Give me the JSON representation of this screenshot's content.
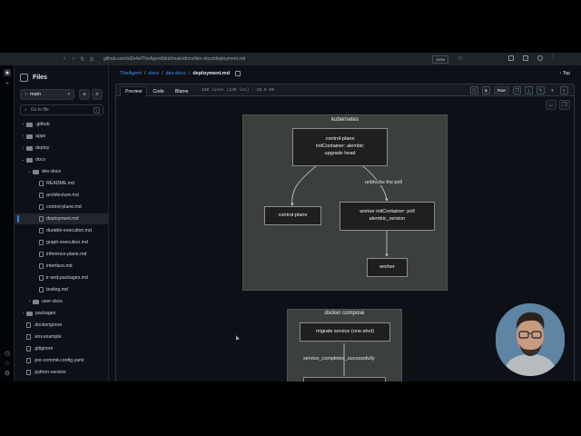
{
  "browser": {
    "url_prefix": "github.com/",
    "url_text": "github.com/ai2e4e/TheAgent/blob/main/docs/dev-docs/deployment.md",
    "zoom_label": "100%"
  },
  "sidebar": {
    "title": "Files",
    "branch": "main",
    "add_label": "+",
    "search_placeholder": "Go to file",
    "search_shortcut": "t",
    "items": [
      {
        "label": ".github",
        "type": "folder",
        "depth": 0,
        "expanded": false
      },
      {
        "label": "apps",
        "type": "folder",
        "depth": 0,
        "expanded": false
      },
      {
        "label": "deploy",
        "type": "folder",
        "depth": 0,
        "expanded": false
      },
      {
        "label": "docs",
        "type": "folder",
        "depth": 0,
        "expanded": true
      },
      {
        "label": "dev-docs",
        "type": "folder",
        "depth": 1,
        "expanded": true
      },
      {
        "label": "README.md",
        "type": "file",
        "depth": 2
      },
      {
        "label": "architecture.md",
        "type": "file",
        "depth": 2
      },
      {
        "label": "control-plane.md",
        "type": "file",
        "depth": 2
      },
      {
        "label": "deployment.md",
        "type": "file",
        "depth": 2,
        "selected": true
      },
      {
        "label": "durable-execution.md",
        "type": "file",
        "depth": 2
      },
      {
        "label": "graph-execution.md",
        "type": "file",
        "depth": 2
      },
      {
        "label": "inference-plane.md",
        "type": "file",
        "depth": 2
      },
      {
        "label": "interface.md",
        "type": "file",
        "depth": 2
      },
      {
        "label": "ir-and-packages.md",
        "type": "file",
        "depth": 2
      },
      {
        "label": "testing.md",
        "type": "file",
        "depth": 2
      },
      {
        "label": "user-docs",
        "type": "folder",
        "depth": 1,
        "expanded": false
      },
      {
        "label": "packages",
        "type": "folder",
        "depth": 0,
        "expanded": false
      },
      {
        "label": ".dockerignore",
        "type": "file",
        "depth": 0
      },
      {
        "label": ".env.example",
        "type": "file",
        "depth": 0
      },
      {
        "label": ".gitignore",
        "type": "file",
        "depth": 0
      },
      {
        "label": ".pre-commit-config.yaml",
        "type": "file",
        "depth": 0
      },
      {
        "label": ".python-version",
        "type": "file",
        "depth": 0
      }
    ]
  },
  "header": {
    "breadcrumbs": [
      "TheAgent",
      "docs",
      "dev-docs"
    ],
    "current_file": "deployment.md",
    "separator": "/",
    "top_label": "Top"
  },
  "toolbar": {
    "tabs": [
      {
        "label": "Preview",
        "active": true
      },
      {
        "label": "Code",
        "active": false
      },
      {
        "label": "Blame",
        "active": false
      }
    ],
    "file_info": "180 lines (138 loc) · 20.8 KB",
    "raw_label": "Raw"
  },
  "diagram": {
    "kubernetes": {
      "title": "kubernetes",
      "init_node": [
        "control-plane",
        "initContainer: alembic",
        "upgrade head"
      ],
      "control_plane": "control-plane",
      "worker_init": [
        "worker initContainer: poll",
        "alembic_version"
      ],
      "worker": "worker",
      "edge_label": "unblocks the poll"
    },
    "docker": {
      "title": "docker compose",
      "migrate": "migrate service (one-shot)",
      "edge_label": "service_completed_successfully"
    }
  }
}
